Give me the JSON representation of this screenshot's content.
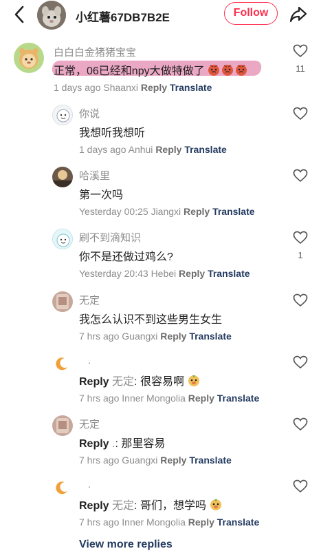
{
  "header": {
    "back_icon": "chevron-left-icon",
    "user_name": "小红薯67DB7B2E",
    "follow_label": "Follow",
    "share_icon": "share-arrow-icon",
    "accent_color": "#ff2e4d"
  },
  "comments": [
    {
      "name": "白白白金猪猪宝宝",
      "text": "正常，06已经和npy大做特做了",
      "time": "1 days ago Shaanxi",
      "reply": "Reply",
      "translate": "Translate",
      "likes": "11"
    },
    {
      "name": "你说",
      "text": "我想听我想听",
      "time": "1 days ago Anhui",
      "reply": "Reply",
      "translate": "Translate"
    },
    {
      "name": "哈溪里",
      "text": "第一次吗",
      "time": "Yesterday 00:25 Jiangxi",
      "reply": "Reply",
      "translate": "Translate"
    },
    {
      "name": "刷不到滴知识",
      "text": "你不是还做过鸡么?",
      "time": "Yesterday 20:43 Hebei",
      "reply": "Reply",
      "translate": "Translate",
      "likes": "1"
    },
    {
      "name": "无定",
      "text": "我怎么认识不到这些男生女生",
      "time": "7 hrs ago Guangxi",
      "reply": "Reply",
      "translate": "Translate"
    },
    {
      "name": ".",
      "reply_word": "Reply",
      "reply_to": "无定",
      "text": ": 很容易啊",
      "time": "7 hrs ago Inner Mongolia",
      "reply": "Reply",
      "translate": "Translate"
    },
    {
      "name": "无定",
      "reply_word": "Reply",
      "reply_to": ".",
      "text": ": 那里容易",
      "time": "7 hrs ago Guangxi",
      "reply": "Reply",
      "translate": "Translate"
    },
    {
      "name": ".",
      "reply_word": "Reply",
      "reply_to": "无定",
      "text": ": 哥们，想学吗",
      "time": "7 hrs ago Inner Mongolia",
      "reply": "Reply",
      "translate": "Translate"
    }
  ],
  "view_more": "View more replies",
  "colors": {
    "translate": "#243b61",
    "muted": "#8c8c8c",
    "highlight": "#db6094"
  }
}
